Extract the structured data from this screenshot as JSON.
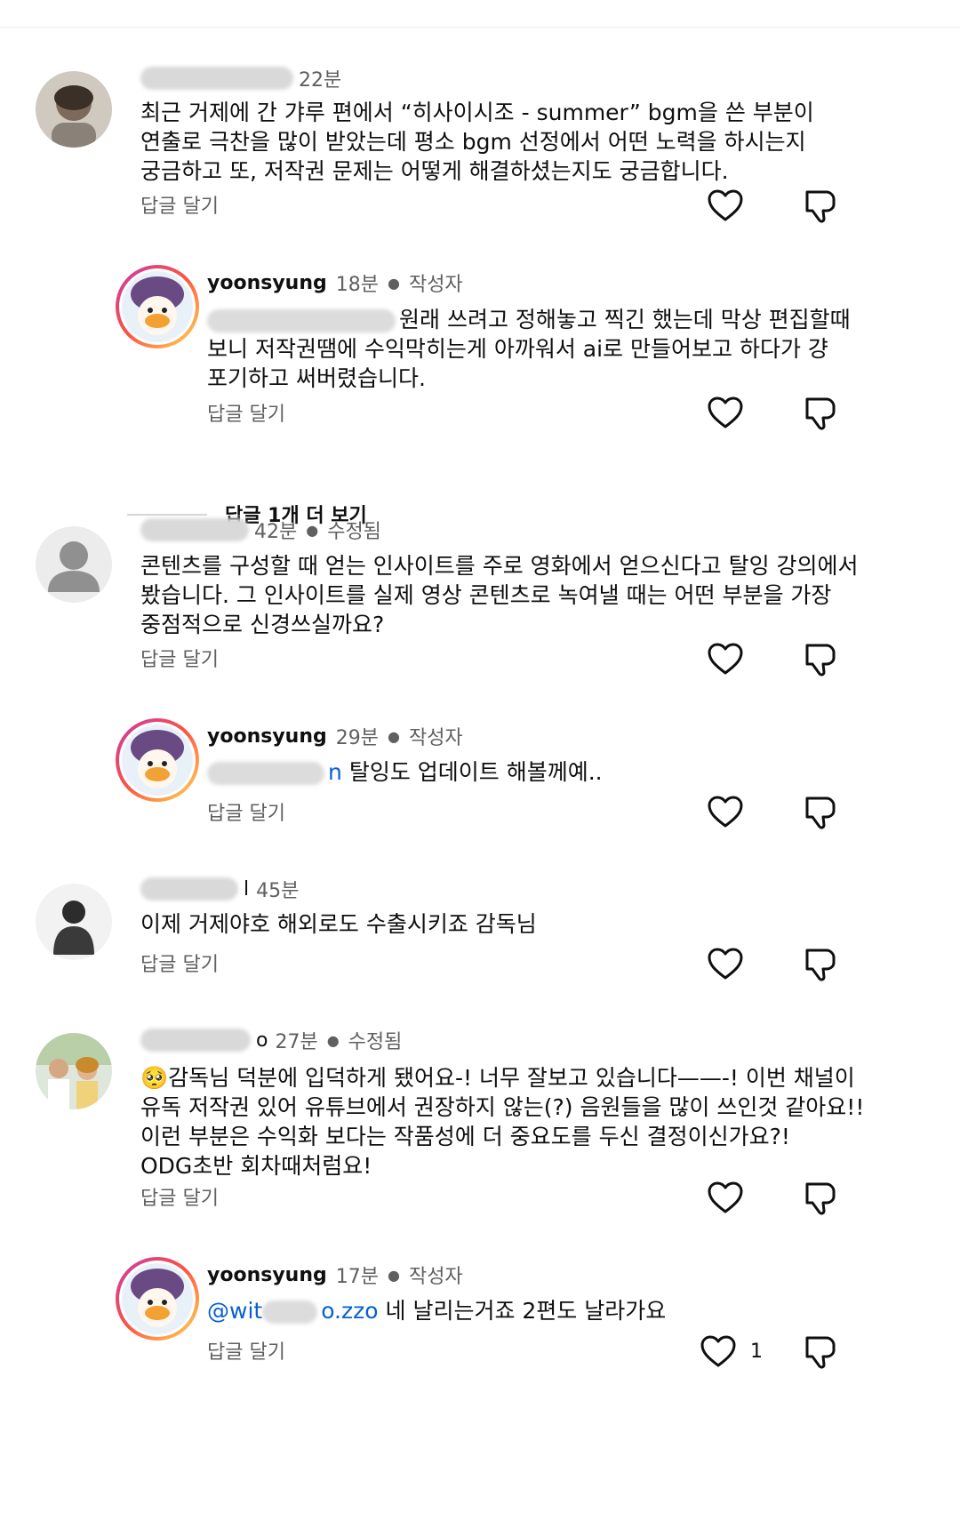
{
  "comments": [
    {
      "user": "",
      "time": "22분",
      "lines": [
        "최근 거제에 간 갸루 편에서 “히사이시조 - summer” bgm을 쓴 부분이",
        "연출로 극찬을 많이 받았는데 평소 bgm 선정에서 어떤 노력을 하시는지",
        "궁금하고 또, 저작권 문제는 어떻게 해결하셨는지도 궁금합니다."
      ],
      "reply": "답글 달기"
    },
    {
      "user": "yoonsyung",
      "time": "18분",
      "author_badge": "작성자",
      "lines": [
        "원래 쓰려고 정해놓고 찍긴 했는데 막상 편집할때",
        "보니 저작권땜에 수익막히는게 아까워서 ai로 만들어보고 하다가 걍",
        "포기하고 써버렸습니다."
      ],
      "reply": "답글 달기"
    },
    {
      "user": "",
      "time": "42분",
      "edited": "수정됨",
      "lines": [
        "콘텐츠를 구성할 때 얻는 인사이트를 주로 영화에서 얻으신다고 탈잉 강의에서",
        "봤습니다. 그 인사이트를 실제 영상 콘텐츠로 녹여낼 때는 어떤 부분을 가장",
        "중점적으로 신경쓰실까요?"
      ],
      "reply": "답글 달기"
    },
    {
      "user": "yoonsyung",
      "time": "29분",
      "author_badge": "작성자",
      "mention_tail": "n",
      "lines": [
        "탈잉도 업데이트 해볼께예.."
      ],
      "reply": "답글 달기"
    },
    {
      "user": "l",
      "time": "45분",
      "lines": [
        "이제 거제야호 해외로도 수출시키죠 감독님"
      ],
      "reply": "답글 달기"
    },
    {
      "user": "o",
      "time": "27분",
      "edited": "수정됨",
      "emoji": "🥺",
      "lines": [
        "감독님 덕분에 입덕하게 됐어요-! 너무 잘보고 있습니다——-! 이번 채널이",
        "유독 저작권 있어 유튜브에서 권장하지 않는(?) 음원들을 많이 쓰인것 같아요!!",
        "이런 부분은 수익화 보다는 작품성에 더 중요도를 두신 결정이신가요?!",
        "ODG초반 회차때처럼요!"
      ],
      "reply": "답글 달기"
    },
    {
      "user": "yoonsyung",
      "time": "17분",
      "author_badge": "작성자",
      "mention_head": "@wit",
      "mention_tail": "o.zzo",
      "lines": [
        "네 날리는거죠 2편도 날라가요"
      ],
      "reply": "답글 달기",
      "likes": "1"
    }
  ],
  "more_replies": "답글 1개 더 보기",
  "icons": {
    "like": "heart-icon",
    "dislike": "thumbs-down-icon"
  }
}
